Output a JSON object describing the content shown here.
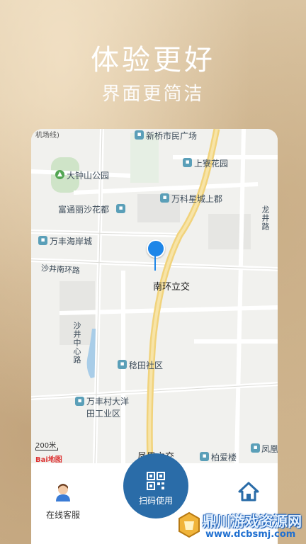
{
  "hero": {
    "title": "体验更好",
    "subtitle": "界面更简洁"
  },
  "map": {
    "labels": {
      "top_left": "机场线)",
      "xinqiao": "新桥市民广场",
      "shangliao": "上寮花园",
      "dazhongshan": "大钟山公园",
      "wanke": "万科星城上郡",
      "fudongli": "富通丽沙花都",
      "longjing_road": "龙井路",
      "wanfeng_haian": "万丰海岸城",
      "shajing_nanhuan": "沙井南环路",
      "nanhuan_li": "南环立交",
      "shajing_zhongxin": "沙井中心路",
      "suotian": "稔田社区",
      "wanfeng_dayang_1": "万丰村大洋",
      "wanfeng_dayang_2": "田工业区",
      "fenghuang_li": "凤凰立交",
      "baiai": "柏爱楼",
      "fenghuang_right": "凤凰"
    },
    "scale": "200米",
    "brand": "Bai地图"
  },
  "tabbar": {
    "service_label": "在线客服",
    "scan_label": "扫码使用"
  },
  "watermark": {
    "line1": "鼎川游戏资源网",
    "line2": "www.dcbsmj.com"
  }
}
